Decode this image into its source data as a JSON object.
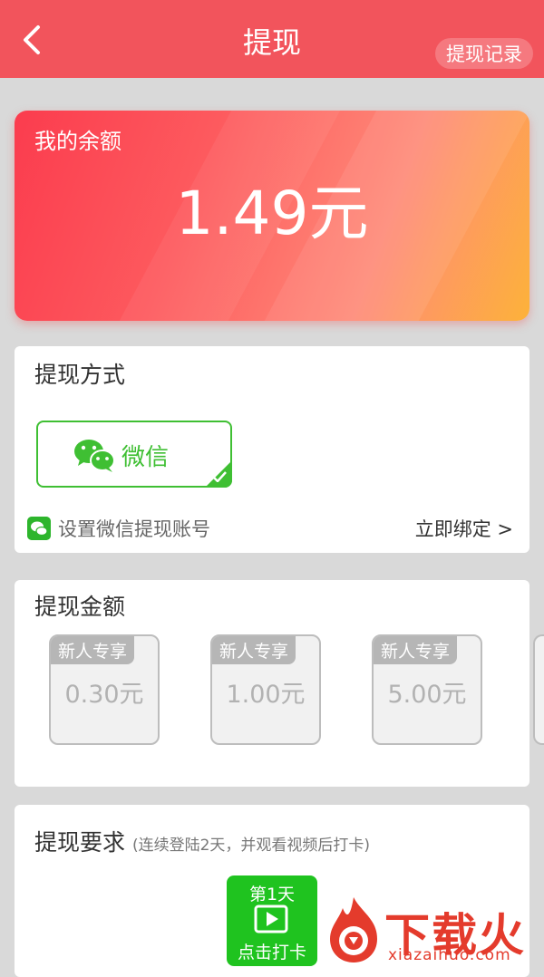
{
  "header": {
    "title": "提现",
    "record_label": "提现记录"
  },
  "balance": {
    "label": "我的余额",
    "value": "1.49元"
  },
  "method": {
    "title": "提现方式",
    "option_label": "微信",
    "bind_label": "设置微信提现账号",
    "bind_action": "立即绑定 >"
  },
  "amount": {
    "title": "提现金额",
    "options": [
      {
        "badge": "新人专享",
        "value": "0.30元"
      },
      {
        "badge": "新人专享",
        "value": "1.00元"
      },
      {
        "badge": "新人专享",
        "value": "5.00元"
      }
    ]
  },
  "requirement": {
    "title": "提现要求",
    "note": "(连续登陆2天，并观看视频后打卡)",
    "day_label": "第1天",
    "checkin_label": "点击打卡"
  },
  "watermark": {
    "name": "下载火",
    "url": "xiazaihuo.com"
  },
  "colors": {
    "header": "#f2545c",
    "wechat_green": "#3fbf33",
    "checkin_green": "#1fc31f"
  }
}
